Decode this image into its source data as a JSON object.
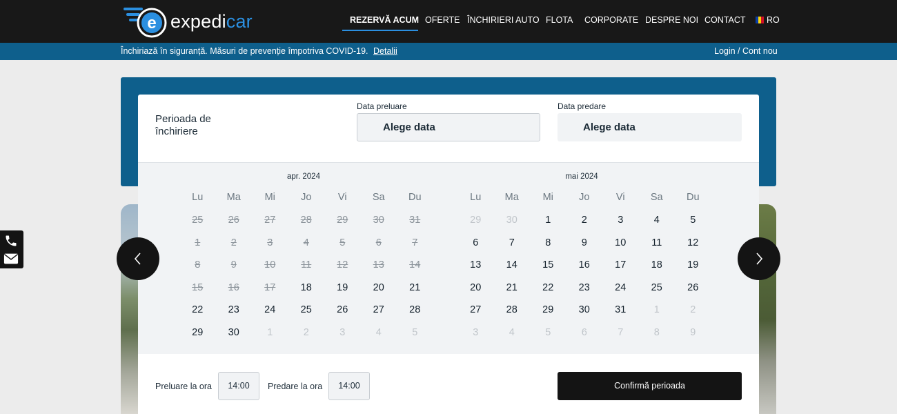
{
  "brand": {
    "logo_text_left": "expedi",
    "logo_text_right": "car",
    "logo_letter": "e"
  },
  "nav": [
    {
      "label": "REZERVĂ ACUM"
    },
    {
      "label": "OFERTE"
    },
    {
      "label": "ÎNCHIRIERI AUTO"
    },
    {
      "label": "FLOTA"
    },
    {
      "label": "CORPORATE"
    },
    {
      "label": "DESPRE NOI"
    },
    {
      "label": "CONTACT"
    },
    {
      "label": "RO"
    }
  ],
  "infobar": {
    "message": "Închiriază în siguranță. Măsuri de prevenție împotriva COVID-19.",
    "details_link": "Detalii",
    "login_link": "Login / Cont nou"
  },
  "booking": {
    "period_label": "Perioada de închiriere",
    "pickup_caption": "Data preluare",
    "pickup_value": "Alege data",
    "return_caption": "Data predare",
    "return_value": "Alege data"
  },
  "calendar": {
    "weekdays": [
      "Lu",
      "Ma",
      "Mi",
      "Jo",
      "Vi",
      "Sa",
      "Du"
    ],
    "months": [
      {
        "title": "apr. 2024",
        "days": [
          {
            "n": "25",
            "s": "past"
          },
          {
            "n": "26",
            "s": "past"
          },
          {
            "n": "27",
            "s": "past"
          },
          {
            "n": "28",
            "s": "past"
          },
          {
            "n": "29",
            "s": "past"
          },
          {
            "n": "30",
            "s": "past"
          },
          {
            "n": "31",
            "s": "past"
          },
          {
            "n": "1",
            "s": "past"
          },
          {
            "n": "2",
            "s": "past"
          },
          {
            "n": "3",
            "s": "past"
          },
          {
            "n": "4",
            "s": "past"
          },
          {
            "n": "5",
            "s": "past"
          },
          {
            "n": "6",
            "s": "past"
          },
          {
            "n": "7",
            "s": "past"
          },
          {
            "n": "8",
            "s": "past"
          },
          {
            "n": "9",
            "s": "past"
          },
          {
            "n": "10",
            "s": "past"
          },
          {
            "n": "11",
            "s": "past"
          },
          {
            "n": "12",
            "s": "past"
          },
          {
            "n": "13",
            "s": "past"
          },
          {
            "n": "14",
            "s": "past"
          },
          {
            "n": "15",
            "s": "past"
          },
          {
            "n": "16",
            "s": "past"
          },
          {
            "n": "17",
            "s": "past"
          },
          {
            "n": "18",
            "s": "avail"
          },
          {
            "n": "19",
            "s": "avail"
          },
          {
            "n": "20",
            "s": "avail"
          },
          {
            "n": "21",
            "s": "avail"
          },
          {
            "n": "22",
            "s": "avail"
          },
          {
            "n": "23",
            "s": "avail"
          },
          {
            "n": "24",
            "s": "avail"
          },
          {
            "n": "25",
            "s": "avail"
          },
          {
            "n": "26",
            "s": "avail"
          },
          {
            "n": "27",
            "s": "avail"
          },
          {
            "n": "28",
            "s": "avail"
          },
          {
            "n": "29",
            "s": "avail"
          },
          {
            "n": "30",
            "s": "avail"
          },
          {
            "n": "1",
            "s": "other"
          },
          {
            "n": "2",
            "s": "other"
          },
          {
            "n": "3",
            "s": "other"
          },
          {
            "n": "4",
            "s": "other"
          },
          {
            "n": "5",
            "s": "other"
          }
        ]
      },
      {
        "title": "mai 2024",
        "days": [
          {
            "n": "29",
            "s": "other"
          },
          {
            "n": "30",
            "s": "other"
          },
          {
            "n": "1",
            "s": "avail"
          },
          {
            "n": "2",
            "s": "avail"
          },
          {
            "n": "3",
            "s": "avail"
          },
          {
            "n": "4",
            "s": "avail"
          },
          {
            "n": "5",
            "s": "avail"
          },
          {
            "n": "6",
            "s": "avail"
          },
          {
            "n": "7",
            "s": "avail"
          },
          {
            "n": "8",
            "s": "avail"
          },
          {
            "n": "9",
            "s": "avail"
          },
          {
            "n": "10",
            "s": "avail"
          },
          {
            "n": "11",
            "s": "avail"
          },
          {
            "n": "12",
            "s": "avail"
          },
          {
            "n": "13",
            "s": "avail"
          },
          {
            "n": "14",
            "s": "avail"
          },
          {
            "n": "15",
            "s": "avail"
          },
          {
            "n": "16",
            "s": "avail"
          },
          {
            "n": "17",
            "s": "avail"
          },
          {
            "n": "18",
            "s": "avail"
          },
          {
            "n": "19",
            "s": "avail"
          },
          {
            "n": "20",
            "s": "avail"
          },
          {
            "n": "21",
            "s": "avail"
          },
          {
            "n": "22",
            "s": "avail"
          },
          {
            "n": "23",
            "s": "avail"
          },
          {
            "n": "24",
            "s": "avail"
          },
          {
            "n": "25",
            "s": "avail"
          },
          {
            "n": "26",
            "s": "avail"
          },
          {
            "n": "27",
            "s": "avail"
          },
          {
            "n": "28",
            "s": "avail"
          },
          {
            "n": "29",
            "s": "avail"
          },
          {
            "n": "30",
            "s": "avail"
          },
          {
            "n": "31",
            "s": "avail"
          },
          {
            "n": "1",
            "s": "other"
          },
          {
            "n": "2",
            "s": "other"
          },
          {
            "n": "3",
            "s": "other"
          },
          {
            "n": "4",
            "s": "other"
          },
          {
            "n": "5",
            "s": "other"
          },
          {
            "n": "6",
            "s": "other"
          },
          {
            "n": "7",
            "s": "other"
          },
          {
            "n": "8",
            "s": "other"
          },
          {
            "n": "9",
            "s": "other"
          }
        ]
      }
    ]
  },
  "times": {
    "pickup_label": "Preluare la ora",
    "pickup_value": "14:00",
    "return_label": "Predare la ora",
    "return_value": "14:00"
  },
  "confirm_label": "Confirmă perioada",
  "icons": {
    "prev": "chevron-left-icon",
    "next": "chevron-right-icon",
    "phone": "phone-icon",
    "mail": "envelope-icon",
    "flag": "romania-flag-icon"
  },
  "colors": {
    "accent_blue": "#0e5f8c",
    "logo_blue": "#2b8fe0",
    "dark": "#141414"
  }
}
